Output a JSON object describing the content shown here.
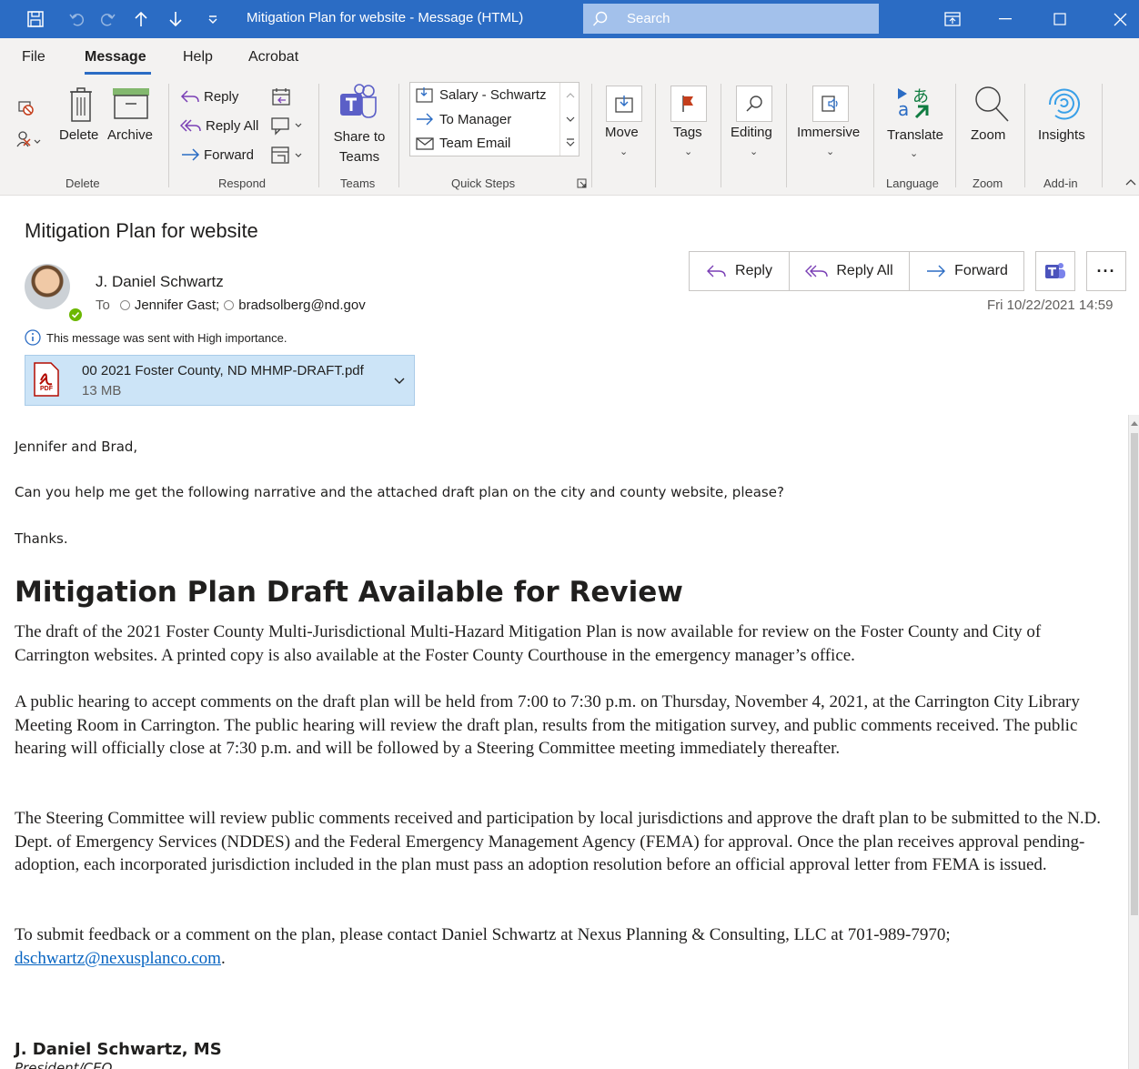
{
  "titlebar": {
    "title": "Mitigation Plan for website  -  Message (HTML)",
    "search_placeholder": "Search"
  },
  "menu": [
    "File",
    "Message",
    "Help",
    "Acrobat"
  ],
  "ribbon": {
    "delete_group": {
      "label": "Delete",
      "delete": "Delete",
      "archive": "Archive"
    },
    "respond_group": {
      "label": "Respond",
      "reply": "Reply",
      "reply_all": "Reply All",
      "forward": "Forward"
    },
    "teams_group": {
      "label": "Teams",
      "share": "Share to Teams"
    },
    "quick_steps": {
      "label": "Quick Steps",
      "items": [
        "Salary - Schwartz",
        "To Manager",
        "Team Email"
      ]
    },
    "move": "Move",
    "tags": "Tags",
    "editing": "Editing",
    "immersive": "Immersive",
    "language": {
      "label": "Language",
      "translate": "Translate"
    },
    "zoom": {
      "label": "Zoom",
      "zoom": "Zoom"
    },
    "addin": {
      "label": "Add-in",
      "insights": "Insights"
    }
  },
  "message": {
    "subject": "Mitigation Plan for website",
    "sender": "J. Daniel Schwartz",
    "to_label": "To",
    "recipients": [
      "Jennifer Gast;",
      "bradsolberg@nd.gov"
    ],
    "importance": "This message was sent with High importance.",
    "date": "Fri 10/22/2021 14:59",
    "attachment": {
      "name": "00 2021 Foster County, ND MHMP-DRAFT.pdf",
      "size": "13 MB",
      "icon_text": "PDF"
    },
    "actions": {
      "reply": "Reply",
      "reply_all": "Reply All",
      "forward": "Forward"
    }
  },
  "body": {
    "greeting": "Jennifer and Brad,",
    "request": "Can you help me get the following narrative and the attached draft plan on the city and county website, please?",
    "thanks": "Thanks.",
    "heading": "Mitigation Plan Draft Available for Review",
    "p1": "The draft of the 2021 Foster County Multi-Jurisdictional Multi-Hazard Mitigation Plan is now available for review on the Foster County and City of Carrington websites.  A printed copy is also available at the Foster County Courthouse in the emergency manager’s office.",
    "p2": "A public hearing to accept comments on the draft plan will be held from 7:00 to 7:30 p.m. on Thursday, November 4, 2021, at the Carrington City Library Meeting Room in Carrington.  The public hearing will review the draft plan, results from the mitigation survey, and public comments received.  The public hearing will officially close at 7:30 p.m. and will be followed by a Steering Committee meeting immediately thereafter.",
    "p3": "The Steering Committee will review public comments received and participation by local jurisdictions and approve the draft plan to be submitted to the N.D. Dept. of Emergency Services (NDDES) and the Federal Emergency Management Agency (FEMA) for approval.  Once the plan receives approval pending-adoption, each incorporated jurisdiction included in the plan must pass an adoption resolution before an official approval letter from FEMA is issued.",
    "p4_prefix": "To submit feedback or a comment on the plan, please contact Daniel Schwartz at Nexus Planning & Consulting, LLC at 701-989-7970; ",
    "p4_link": "dschwartz@nexusplanco.com",
    "p4_suffix": ".",
    "signature_name": "J. Daniel Schwartz, MS",
    "signature_title": "President/CEO"
  }
}
